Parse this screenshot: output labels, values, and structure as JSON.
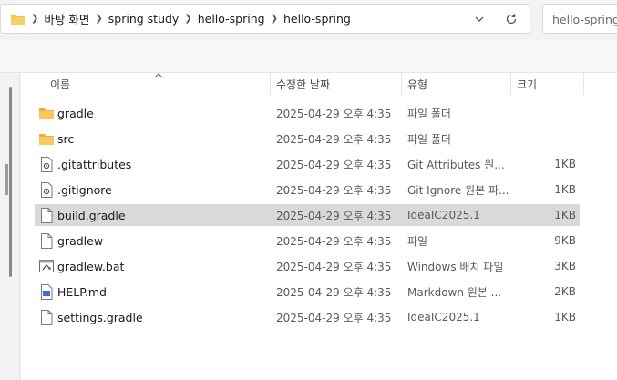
{
  "address_bar": {
    "breadcrumbs": [
      "바탕 화면",
      "spring study",
      "hello-spring",
      "hello-spring"
    ]
  },
  "search": {
    "placeholder": "hello-spring 검"
  },
  "columns": {
    "name": "이름",
    "date": "수정한 날짜",
    "type": "유형",
    "size": "크기"
  },
  "files": [
    {
      "icon": "folder-icon",
      "name": "gradle",
      "date": "2025-04-29 오후 4:35",
      "type": "파일 폴더",
      "size": ""
    },
    {
      "icon": "folder-icon",
      "name": "src",
      "date": "2025-04-29 오후 4:35",
      "type": "파일 폴더",
      "size": ""
    },
    {
      "icon": "settings-file-icon",
      "name": ".gitattributes",
      "date": "2025-04-29 오후 4:35",
      "type": "Git Attributes 원...",
      "size": "1KB"
    },
    {
      "icon": "settings-file-icon",
      "name": ".gitignore",
      "date": "2025-04-29 오후 4:35",
      "type": "Git Ignore 원본 파...",
      "size": "1KB"
    },
    {
      "icon": "file-icon",
      "name": "build.gradle",
      "date": "2025-04-29 오후 4:35",
      "type": "IdeaIC2025.1",
      "size": "1KB"
    },
    {
      "icon": "file-icon",
      "name": "gradlew",
      "date": "2025-04-29 오후 4:35",
      "type": "파일",
      "size": "9KB"
    },
    {
      "icon": "batch-file-icon",
      "name": "gradlew.bat",
      "date": "2025-04-29 오후 4:35",
      "type": "Windows 배치 파일",
      "size": "3KB"
    },
    {
      "icon": "markdown-file-icon",
      "name": "HELP.md",
      "date": "2025-04-29 오후 4:35",
      "type": "Markdown 원본 ...",
      "size": "2KB"
    },
    {
      "icon": "file-icon",
      "name": "settings.gradle",
      "date": "2025-04-29 오후 4:35",
      "type": "IdeaIC2025.1",
      "size": "1KB"
    }
  ],
  "selected_index": 4,
  "colors": {
    "folder": "#f2c14e",
    "selected_row": "#d9d9d9",
    "window_bg": "#f3f3f3"
  }
}
